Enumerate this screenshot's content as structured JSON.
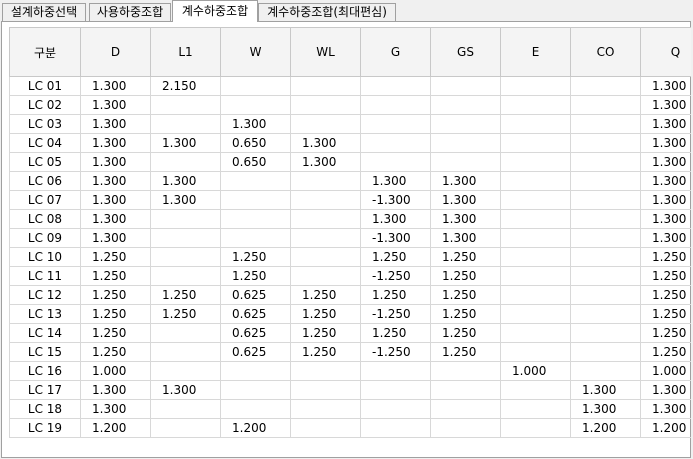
{
  "tabs": [
    {
      "label": "설계하중선택",
      "active": false
    },
    {
      "label": "사용하중조합",
      "active": false
    },
    {
      "label": "계수하중조합",
      "active": true
    },
    {
      "label": "계수하중조합(최대편심)",
      "active": false
    }
  ],
  "table": {
    "columns": [
      "구분",
      "D",
      "L1",
      "W",
      "WL",
      "G",
      "GS",
      "E",
      "CO",
      "Q"
    ],
    "rows": [
      [
        "LC 01",
        "1.300",
        "2.150",
        "",
        "",
        "",
        "",
        "",
        "",
        "1.300"
      ],
      [
        "LC 02",
        "1.300",
        "",
        "",
        "",
        "",
        "",
        "",
        "",
        "1.300"
      ],
      [
        "LC 03",
        "1.300",
        "",
        "1.300",
        "",
        "",
        "",
        "",
        "",
        "1.300"
      ],
      [
        "LC 04",
        "1.300",
        "1.300",
        "0.650",
        "1.300",
        "",
        "",
        "",
        "",
        "1.300"
      ],
      [
        "LC 05",
        "1.300",
        "",
        "0.650",
        "1.300",
        "",
        "",
        "",
        "",
        "1.300"
      ],
      [
        "LC 06",
        "1.300",
        "1.300",
        "",
        "",
        "1.300",
        "1.300",
        "",
        "",
        "1.300"
      ],
      [
        "LC 07",
        "1.300",
        "1.300",
        "",
        "",
        "-1.300",
        "1.300",
        "",
        "",
        "1.300"
      ],
      [
        "LC 08",
        "1.300",
        "",
        "",
        "",
        "1.300",
        "1.300",
        "",
        "",
        "1.300"
      ],
      [
        "LC 09",
        "1.300",
        "",
        "",
        "",
        "-1.300",
        "1.300",
        "",
        "",
        "1.300"
      ],
      [
        "LC 10",
        "1.250",
        "",
        "1.250",
        "",
        "1.250",
        "1.250",
        "",
        "",
        "1.250"
      ],
      [
        "LC 11",
        "1.250",
        "",
        "1.250",
        "",
        "-1.250",
        "1.250",
        "",
        "",
        "1.250"
      ],
      [
        "LC 12",
        "1.250",
        "1.250",
        "0.625",
        "1.250",
        "1.250",
        "1.250",
        "",
        "",
        "1.250"
      ],
      [
        "LC 13",
        "1.250",
        "1.250",
        "0.625",
        "1.250",
        "-1.250",
        "1.250",
        "",
        "",
        "1.250"
      ],
      [
        "LC 14",
        "1.250",
        "",
        "0.625",
        "1.250",
        "1.250",
        "1.250",
        "",
        "",
        "1.250"
      ],
      [
        "LC 15",
        "1.250",
        "",
        "0.625",
        "1.250",
        "-1.250",
        "1.250",
        "",
        "",
        "1.250"
      ],
      [
        "LC 16",
        "1.000",
        "",
        "",
        "",
        "",
        "",
        "1.000",
        "",
        "1.000"
      ],
      [
        "LC 17",
        "1.300",
        "1.300",
        "",
        "",
        "",
        "",
        "",
        "1.300",
        "1.300"
      ],
      [
        "LC 18",
        "1.300",
        "",
        "",
        "",
        "",
        "",
        "",
        "1.300",
        "1.300"
      ],
      [
        "LC 19",
        "1.200",
        "",
        "1.200",
        "",
        "",
        "",
        "",
        "1.200",
        "1.200"
      ]
    ]
  }
}
